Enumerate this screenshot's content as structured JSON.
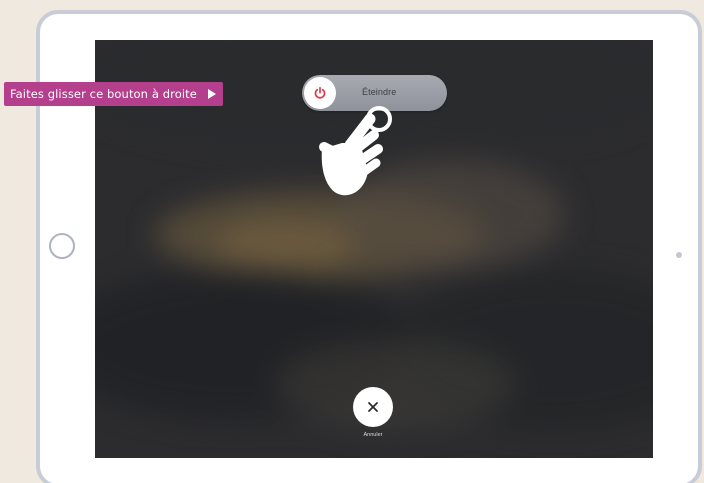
{
  "instruction": {
    "text": "Faites glisser ce bouton à droite",
    "arrow_icon": "play-arrow-icon",
    "color": "#b33f8d"
  },
  "slider": {
    "label": "Éteindre",
    "knob_icon": "power-icon",
    "icon_color": "#e2394a"
  },
  "gesture": {
    "icon": "hand-swipe-icon"
  },
  "cancel": {
    "label": "Annuler",
    "icon": "close-icon"
  },
  "device": {
    "frame_color": "#c8ccd6",
    "home_icon": "home-button-icon"
  }
}
